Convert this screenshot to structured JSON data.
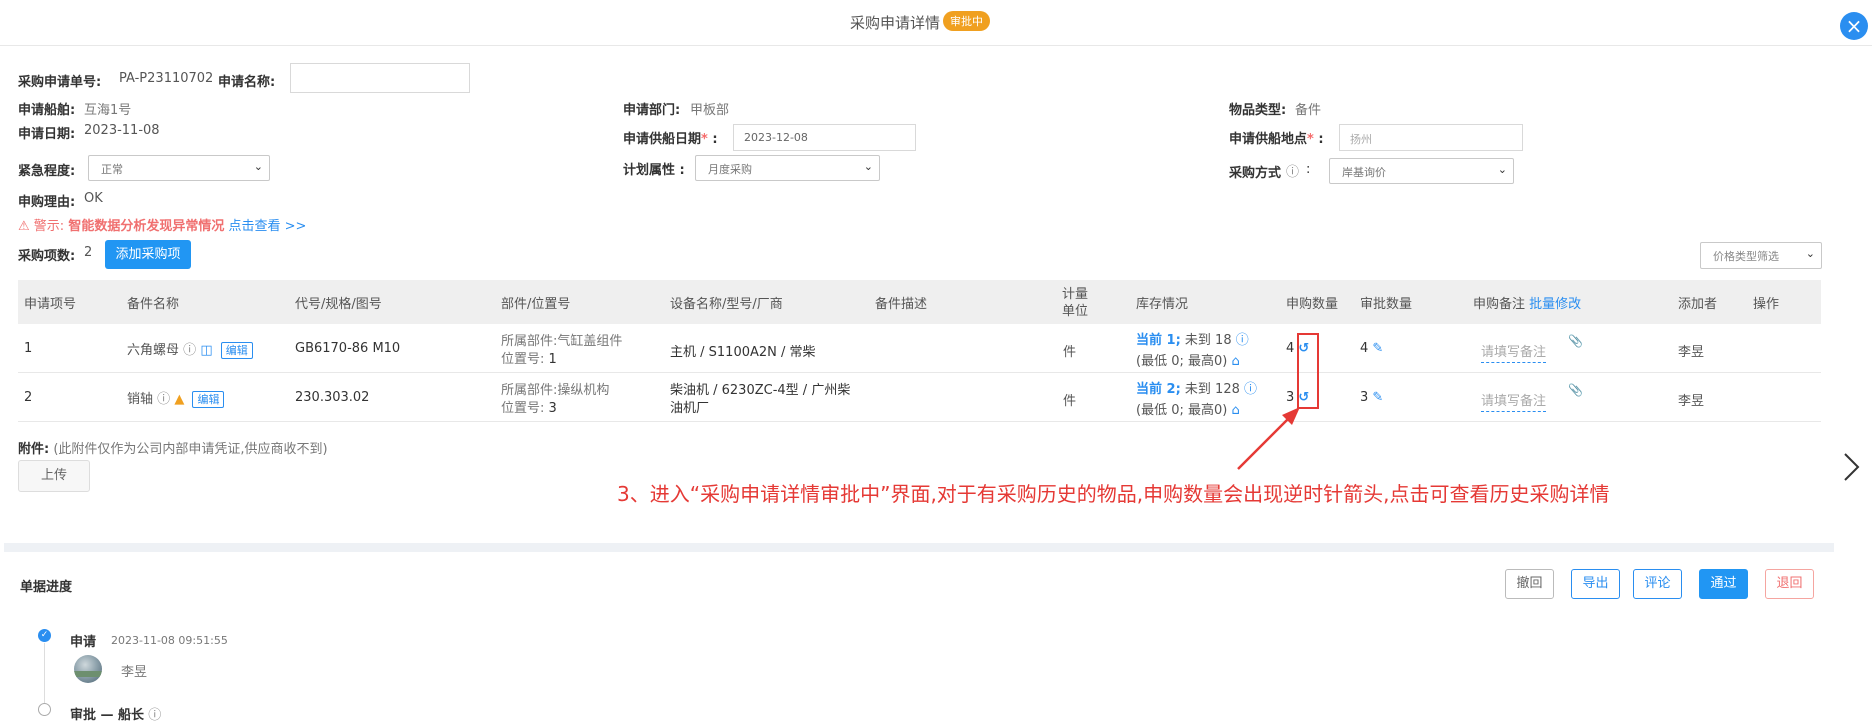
{
  "header": {
    "title": "采购申请详情",
    "status": "审批中"
  },
  "form": {
    "request_no_label": "采购申请单号:",
    "request_no": "PA-P23110702",
    "request_name_label": "申请名称:",
    "ship_label": "申请船舶:",
    "ship": "互海1号",
    "dept_label": "申请部门:",
    "dept": "甲板部",
    "goods_type_label": "物品类型:",
    "goods_type": "备件",
    "date_label": "申请日期:",
    "date": "2023-11-08",
    "supply_date_label": "申请供船日期",
    "supply_date": "2023-12-08",
    "supply_place_label": "申请供船地点",
    "supply_place_placeholder": "扬州",
    "urgency_label": "紧急程度:",
    "urgency": "正常",
    "plan_label": "计划属性 :",
    "plan": "月度采购",
    "method_label": "采购方式",
    "method": "岸基询价",
    "reason_label": "申购理由:",
    "reason": "OK",
    "warning_prefix": "警示:",
    "warning_text": "智能数据分析发现异常情况",
    "warning_link": "点击查看 >>",
    "item_count_label": "采购项数:",
    "item_count": "2",
    "add_item_button": "添加采购项",
    "price_filter": "价格类型筛选"
  },
  "table": {
    "headers": {
      "item_no": "申请项号",
      "part_name": "备件名称",
      "code": "代号/规格/图号",
      "component": "部件/位置号",
      "equipment": "设备名称/型号/厂商",
      "desc": "备件描述",
      "unit_1": "计量",
      "unit_2": "单位",
      "stock": "库存情况",
      "req_qty": "申购数量",
      "appr_qty": "审批数量",
      "remark": "申购备注",
      "batch_edit": "批量修改",
      "adder": "添加者",
      "op": "操作"
    },
    "rows": [
      {
        "no": "1",
        "name": "六角螺母",
        "edit": "编辑",
        "code": "GB6170-86 M10",
        "component_line1": "所属部件:气缸盖组件",
        "component_line2_label": "位置号:",
        "component_line2_val": "1",
        "equipment_line1": "主机 / S1100A2N / 常柴",
        "equipment_line2": "",
        "unit": "件",
        "stock_current": "当前 1;",
        "stock_pending": "未到 18",
        "stock_range": "(最低 0; 最高0)",
        "req_qty": "4",
        "appr_qty": "4",
        "remark_placeholder": "请填写备注",
        "adder": "李昱"
      },
      {
        "no": "2",
        "name": "销轴",
        "edit": "编辑",
        "code": "230.303.02",
        "component_line1": "所属部件:操纵机构",
        "component_line2_label": "位置号:",
        "component_line2_val": "3",
        "equipment_line1": "柴油机 / 6230ZC-4型 / 广州柴",
        "equipment_line2": "油机厂",
        "unit": "件",
        "stock_current": "当前 2;",
        "stock_pending": "未到 128",
        "stock_range": "(最低 0; 最高0)",
        "req_qty": "3",
        "appr_qty": "3",
        "remark_placeholder": "请填写备注",
        "adder": "李昱"
      }
    ]
  },
  "attachment": {
    "label": "附件:",
    "note": "(此附件仅作为公司内部申请凭证,供应商收不到)",
    "upload_button": "上传"
  },
  "annotation": "3、进入“采购申请详情审批中”界面,对于有采购历史的物品,申购数量会出现逆时针箭头,点击可查看历史采购详情",
  "progress": {
    "title": "单据进度",
    "buttons": {
      "withdraw": "撤回",
      "export": "导出",
      "comment": "评论",
      "approve": "通过",
      "reject": "退回"
    },
    "steps": [
      {
        "name": "申请",
        "time": "2023-11-08 09:51:55",
        "user": "李昱"
      },
      {
        "name": "审批 — 船长"
      }
    ]
  },
  "colors": {
    "accent": "#2196f3",
    "status": "#f0a020",
    "warning": "#f07070",
    "annotation": "#e53935"
  }
}
